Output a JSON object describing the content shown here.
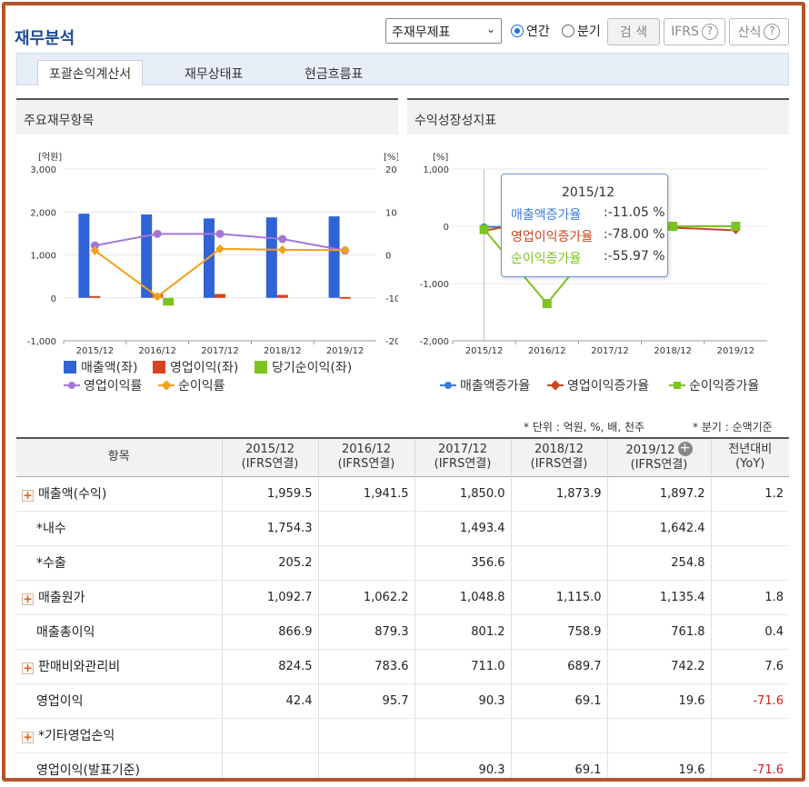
{
  "header": {
    "title": "재무분석",
    "select_value": "주재무제표",
    "radio_annual": "연간",
    "radio_quarter": "분기",
    "search_btn": "검 색",
    "ifrs_btn": "IFRS",
    "formula_btn": "산식"
  },
  "tabs": [
    "포괄손익계산서",
    "재무상태표",
    "현금흐름표"
  ],
  "left_panel": {
    "title": "주요재무항목",
    "legend": [
      "매출액(좌)",
      "영업이익(좌)",
      "당기순이익(좌)",
      "영업이익률",
      "순이익률"
    ]
  },
  "right_panel": {
    "title": "수익성장성지표",
    "legend": [
      "매출액증가율",
      "영업이익증가율",
      "순이익증가율"
    ]
  },
  "tooltip": {
    "period": "2015/12",
    "rows": [
      {
        "label": "매출액증가율",
        "value": ":-11.05 %"
      },
      {
        "label": "영업이익증가율",
        "value": ":-78.00 %"
      },
      {
        "label": "순이익증가율",
        "value": ":-55.97 %"
      }
    ]
  },
  "colors": {
    "revenue": "#2f63d6",
    "op_income": "#d9411f",
    "net_income": "#7dc321",
    "op_margin": "#a477d6",
    "net_margin": "#f2a21b",
    "growth_rev": "#3c7cd9",
    "growth_op": "#c9461e",
    "growth_net": "#7dc321"
  },
  "chart_data": [
    {
      "type": "bar",
      "categories": [
        "2015/12",
        "2016/12",
        "2017/12",
        "2018/12",
        "2019/12"
      ],
      "ylabel_left": "[억원]",
      "ylabel_right": "[%]",
      "ylim": [
        -1000,
        3000
      ],
      "ylim_right": [
        -20,
        20
      ],
      "yticks": [
        "3,000",
        "2,000",
        "1,000",
        "0",
        "-1,000"
      ],
      "yticks_right": [
        "20",
        "10",
        "0",
        "-10",
        "-20"
      ],
      "series": [
        {
          "name": "매출액(좌)",
          "axis": "left",
          "kind": "bar",
          "values": [
            1959.5,
            1941.5,
            1850.0,
            1873.9,
            1897.2
          ]
        },
        {
          "name": "영업이익(좌)",
          "axis": "left",
          "kind": "bar",
          "values": [
            42.4,
            95.7,
            90.3,
            69.1,
            19.6
          ]
        },
        {
          "name": "당기순이익(좌)",
          "axis": "left",
          "kind": "bar",
          "values": [
            0,
            -180,
            0,
            0,
            0
          ]
        },
        {
          "name": "영업이익률",
          "axis": "right",
          "kind": "line",
          "values": [
            2.2,
            4.9,
            4.9,
            3.7,
            1.0
          ]
        },
        {
          "name": "순이익률",
          "axis": "right",
          "kind": "line",
          "values": [
            1.0,
            -9.7,
            1.4,
            1.2,
            1.1
          ]
        }
      ]
    },
    {
      "type": "line",
      "categories": [
        "2015/12",
        "2016/12",
        "2017/12",
        "2018/12",
        "2019/12"
      ],
      "ylabel": "[%]",
      "ylim": [
        -2000,
        1000
      ],
      "yticks": [
        "1,000",
        "0",
        "-1,000",
        "-2,000"
      ],
      "series": [
        {
          "name": "매출액증가율",
          "values": [
            -11.05,
            -0.9,
            -4.7,
            1.3,
            1.2
          ]
        },
        {
          "name": "영업이익증가율",
          "values": [
            -78.0,
            125.7,
            -5.6,
            -23.5,
            -71.6
          ]
        },
        {
          "name": "순이익증가율",
          "values": [
            -55.97,
            -1350,
            0,
            0,
            0
          ]
        }
      ]
    }
  ],
  "notes": {
    "unit": "* 단위 : 억원, %, 배, 천주",
    "quarter": "* 분기 : 순액기준"
  },
  "table": {
    "head_item": "항목",
    "head_cols": [
      {
        "year": "2015/12",
        "sub": "(IFRS연결)"
      },
      {
        "year": "2016/12",
        "sub": "(IFRS연결)"
      },
      {
        "year": "2017/12",
        "sub": "(IFRS연결)"
      },
      {
        "year": "2018/12",
        "sub": "(IFRS연결)"
      },
      {
        "year": "2019/12",
        "sub": "(IFRS연결)"
      }
    ],
    "head_yoy": "전년대비",
    "head_yoy_sub": "(YoY)",
    "rows": [
      {
        "label": "매출액(수익)",
        "expand": true,
        "vals": [
          "1,959.5",
          "1,941.5",
          "1,850.0",
          "1,873.9",
          "1,897.2",
          "1.2"
        ]
      },
      {
        "label": "*내수",
        "expand": false,
        "vals": [
          "1,754.3",
          "",
          "1,493.4",
          "",
          "1,642.4",
          ""
        ]
      },
      {
        "label": "*수출",
        "expand": false,
        "vals": [
          "205.2",
          "",
          "356.6",
          "",
          "254.8",
          ""
        ]
      },
      {
        "label": "매출원가",
        "expand": true,
        "vals": [
          "1,092.7",
          "1,062.2",
          "1,048.8",
          "1,115.0",
          "1,135.4",
          "1.8"
        ]
      },
      {
        "label": "매출총이익",
        "expand": false,
        "vals": [
          "866.9",
          "879.3",
          "801.2",
          "758.9",
          "761.8",
          "0.4"
        ]
      },
      {
        "label": "판매비와관리비",
        "expand": true,
        "vals": [
          "824.5",
          "783.6",
          "711.0",
          "689.7",
          "742.2",
          "7.6"
        ]
      },
      {
        "label": "영업이익",
        "expand": false,
        "vals": [
          "42.4",
          "95.7",
          "90.3",
          "69.1",
          "19.6",
          "-71.6"
        ]
      },
      {
        "label": "*기타영업손익",
        "expand": true,
        "vals": [
          "",
          "",
          "",
          "",
          "",
          ""
        ]
      },
      {
        "label": "영업이익(발표기준)",
        "expand": false,
        "vals": [
          "",
          "",
          "90.3",
          "69.1",
          "19.6",
          "-71.6"
        ]
      }
    ]
  }
}
